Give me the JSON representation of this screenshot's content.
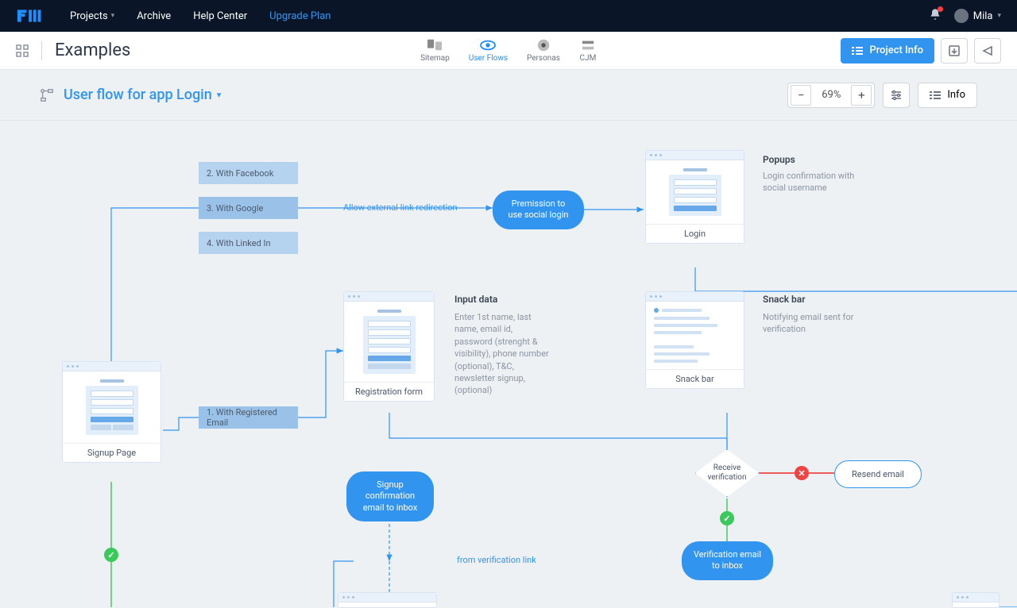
{
  "nav": {
    "projects": "Projects",
    "archive": "Archive",
    "help": "Help Center",
    "upgrade": "Upgrade Plan",
    "user": "Mila"
  },
  "modes": {
    "sitemap": "Sitemap",
    "userflows": "User Flows",
    "personas": "Personas",
    "cjm": "CJM"
  },
  "page": {
    "title": "Examples",
    "project_info": "Project Info",
    "info": "Info"
  },
  "flow": {
    "title": "User flow for app Login",
    "zoom": "69%"
  },
  "nodes": {
    "signup_page": "Signup Page",
    "with_facebook": "2. With Facebook",
    "with_google": "3. With Google",
    "with_linkedin": "4. With Linked In",
    "with_registered": "1. With Registered Email",
    "allow_external": "Allow external link redirection",
    "permission": "Premission to use social login",
    "login": "Login",
    "registration_form": "Registration form",
    "snack_bar": "Snack bar",
    "signup_confirmation": "Signup confirmation email to inbox",
    "from_verification": "from verification link",
    "receive_verification_l1": "Receive",
    "receive_verification_l2": "verification",
    "resend_email": "Resend email",
    "verification_email": "Verification email to inbox"
  },
  "annotations": {
    "popups_title": "Popups",
    "popups_text": "Login confirmation with social username",
    "input_title": "Input data",
    "input_text": "Enter 1st name, last name, email id, password (strenght & visibility), phone number (optional), T&C, newsletter signup, (optional)",
    "snack_title": "Snack bar",
    "snack_text": "Notifying email sent for verification"
  }
}
